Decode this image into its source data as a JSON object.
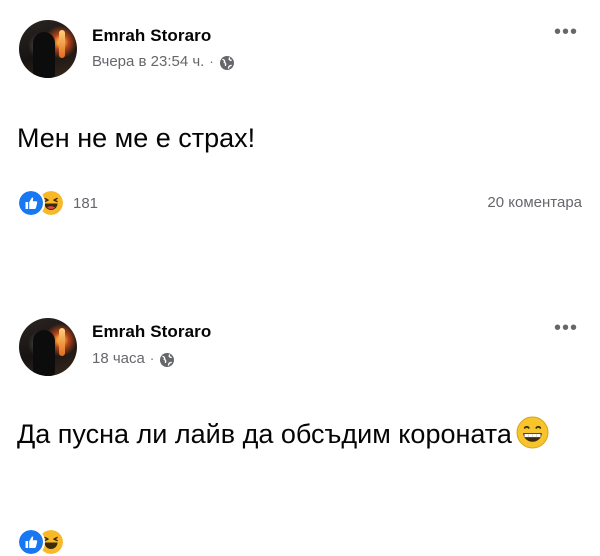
{
  "posts": [
    {
      "author": "Emrah Storaro",
      "timestamp": "Вчера в 23:54 ч.",
      "dot": "·",
      "privacy_icon": "globe-icon",
      "text": "Мен не ме е страх!",
      "reaction_count": "181",
      "reactions": [
        "like-icon",
        "haha-icon"
      ],
      "comments": "20 коментара"
    },
    {
      "author": "Emrah Storaro",
      "timestamp": "18 часа",
      "dot": "·",
      "privacy_icon": "globe-icon",
      "text": "Да пусна ли лайв да обсъдим короната",
      "text_emoji": "grinning-face-icon"
    }
  ],
  "more_label": "•••",
  "colors": {
    "text": "#050505",
    "secondary": "#65676b",
    "like_blue": "#1877f2",
    "haha_yellow": "#f7b928"
  }
}
